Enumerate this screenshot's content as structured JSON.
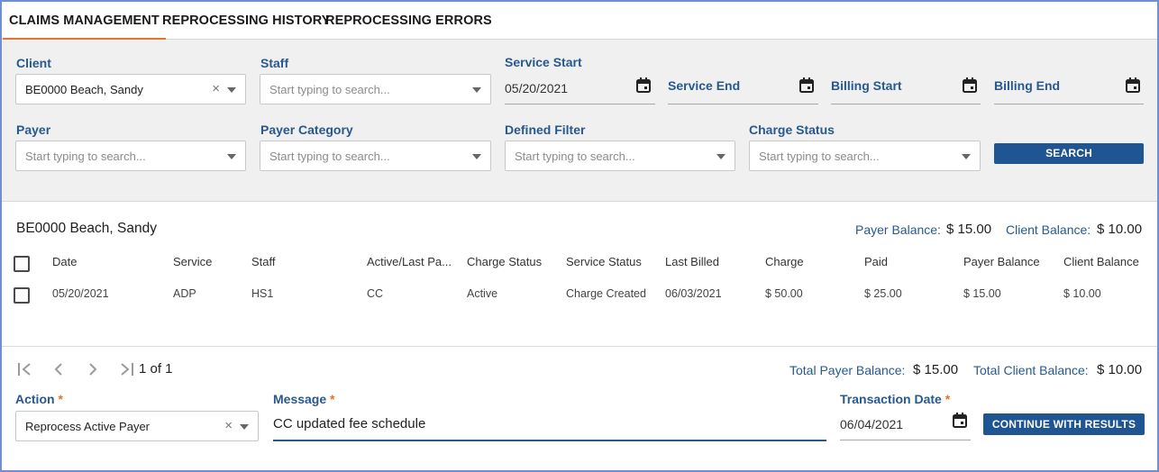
{
  "tabs": [
    {
      "label": "CLAIMS MANAGEMENT",
      "active": true
    },
    {
      "label": "REPROCESSING HISTORY"
    },
    {
      "label": "REPROCESSING ERRORS"
    }
  ],
  "filters": {
    "client": {
      "label": "Client",
      "value": "BE0000 Beach, Sandy"
    },
    "staff": {
      "label": "Staff",
      "placeholder": "Start typing to search..."
    },
    "service_start": {
      "label": "Service Start",
      "value": "05/20/2021"
    },
    "service_end": {
      "label": "Service End"
    },
    "billing_start": {
      "label": "Billing Start"
    },
    "billing_end": {
      "label": "Billing End"
    },
    "payer": {
      "label": "Payer",
      "placeholder": "Start typing to search..."
    },
    "payer_category": {
      "label": "Payer Category",
      "placeholder": "Start typing to search..."
    },
    "defined_filter": {
      "label": "Defined Filter",
      "placeholder": "Start typing to search..."
    },
    "charge_status": {
      "label": "Charge Status",
      "placeholder": "Start typing to search..."
    },
    "search_label": "SEARCH"
  },
  "results": {
    "client_name": "BE0000 Beach, Sandy",
    "payer_balance_label": "Payer Balance:",
    "payer_balance": "$ 15.00",
    "client_balance_label": "Client Balance:",
    "client_balance": "$ 10.00",
    "columns": [
      "Date",
      "Service",
      "Staff",
      "Active/Last Pa...",
      "Charge Status",
      "Service Status",
      "Last Billed",
      "Charge",
      "Paid",
      "Payer Balance",
      "Client Balance"
    ],
    "rows": [
      [
        "05/20/2021",
        "ADP",
        "HS1",
        "CC",
        "Active",
        "Charge Created",
        "06/03/2021",
        "$ 50.00",
        "$ 25.00",
        "$ 15.00",
        "$ 10.00"
      ]
    ]
  },
  "pager": {
    "text": "1 of 1",
    "total_payer_label": "Total Payer Balance:",
    "total_payer": "$ 15.00",
    "total_client_label": "Total Client Balance:",
    "total_client": "$ 10.00"
  },
  "action_form": {
    "action_label": "Action",
    "action_value": "Reprocess Active Payer",
    "message_label": "Message",
    "message_value": "CC updated fee schedule",
    "transaction_date_label": "Transaction Date",
    "transaction_date": "06/04/2021",
    "required_mark": "*",
    "continue_label": "CONTINUE WITH RESULTS"
  },
  "colors": {
    "accent": "#e0752b",
    "label_blue": "#27598f",
    "button_blue": "#1f5592"
  }
}
